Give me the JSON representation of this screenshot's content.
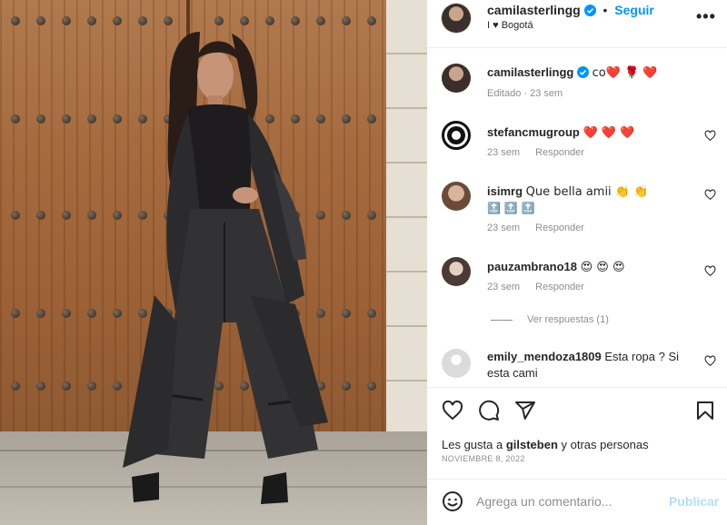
{
  "post": {
    "author": "camilasterlingg",
    "follow_label": "Seguir",
    "location": "I ♥ Bogotá",
    "caption_text": "co❤️ 🌹 ❤️",
    "caption_meta": "Editado · 23 sem"
  },
  "comments": [
    {
      "user": "stefancmugroup",
      "text": "❤️ ❤️ ❤️",
      "time": "23 sem",
      "reply": "Responder"
    },
    {
      "user": "isimrg",
      "text": "Que bella amii 👏 👏",
      "extra": "🔝 🔝 🔝",
      "time": "23 sem",
      "reply": "Responder"
    },
    {
      "user": "pauzambrano18",
      "text": "😍 😍 😍",
      "time": "23 sem",
      "reply": "Responder"
    },
    {
      "user": "emily_mendoza1809",
      "text": "Esta ropa ? Si esta cami"
    }
  ],
  "view_replies": "Ver respuestas (1)",
  "likes": {
    "prefix": "Les gusta a ",
    "user": "gilsteben",
    "suffix": " y otras personas"
  },
  "date": "NOVIEMBRE 8, 2022",
  "add_comment": {
    "placeholder": "Agrega un comentario...",
    "publish_label": "Publicar"
  },
  "icons": {
    "verified": "verified-badge-icon",
    "more": "more-options-icon",
    "like": "heart-icon",
    "comment": "comment-icon",
    "share": "share-icon",
    "save": "bookmark-icon",
    "emoji": "emoji-icon"
  },
  "colors": {
    "accent": "#0095f6",
    "publish_disabled": "#b2dffc",
    "muted": "#8e8e8e"
  }
}
